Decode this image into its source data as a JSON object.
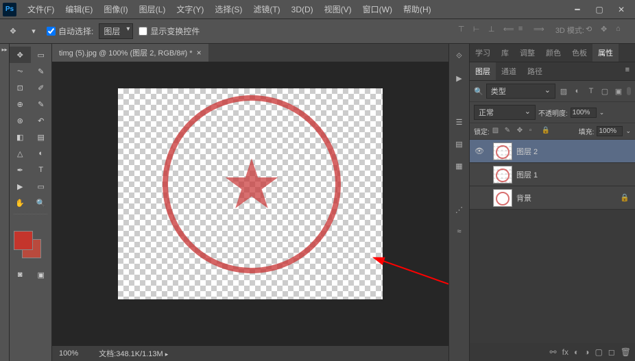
{
  "menus": {
    "file": "文件(F)",
    "edit": "编辑(E)",
    "image": "图像(I)",
    "layer": "图层(L)",
    "type": "文字(Y)",
    "select": "选择(S)",
    "filter": "滤镜(T)",
    "threed": "3D(D)",
    "view": "视图(V)",
    "window": "窗口(W)",
    "help": "帮助(H)"
  },
  "options": {
    "auto_select": "自动选择:",
    "layer_dropdown": "图层",
    "show_transform": "显示变换控件",
    "mode_3d": "3D 模式:"
  },
  "document": {
    "tab_title": "timg (5).jpg @ 100% (图层 2, RGB/8#) *",
    "zoom": "100%",
    "doc_info_label": "文档:",
    "doc_info": "348.1K/1.13M"
  },
  "top_panel_tabs": {
    "learn": "学习",
    "library": "库",
    "adjust": "调整",
    "color": "颜色",
    "swatches": "色板",
    "properties": "属性"
  },
  "layer_panel_tabs": {
    "layers": "图层",
    "channels": "通道",
    "paths": "路径"
  },
  "layer_controls": {
    "filter_type": "类型",
    "blend_mode": "正常",
    "opacity_label": "不透明度:",
    "opacity_value": "100%",
    "lock_label": "锁定:",
    "fill_label": "填充:",
    "fill_value": "100%"
  },
  "layers": [
    {
      "name": "图层 2",
      "visible": true,
      "selected": true,
      "locked": false
    },
    {
      "name": "图层 1",
      "visible": false,
      "selected": false,
      "locked": false
    },
    {
      "name": "背景",
      "visible": false,
      "selected": false,
      "locked": true
    }
  ],
  "colors": {
    "foreground": "#c4352c",
    "background_swatch": "#b94a3d",
    "stamp_red": "rgba(200, 50, 50, 0.75)"
  },
  "icons": {
    "search": "🔍"
  }
}
